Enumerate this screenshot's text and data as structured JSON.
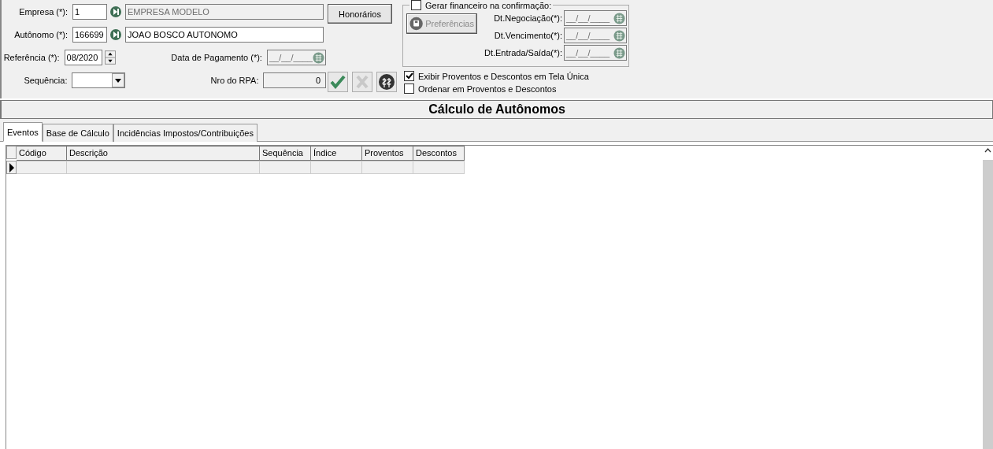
{
  "form": {
    "empresa": {
      "label": "Empresa (*):",
      "code": "1",
      "name": "EMPRESA MODELO",
      "name_disabled": true
    },
    "autonomo": {
      "label": "Autônomo (*):",
      "code": "166699",
      "name": "JOAO BOSCO AUTONOMO",
      "name_disabled": false
    },
    "referencia": {
      "label": "Referência (*):",
      "value": "08/2020"
    },
    "data_pagamento": {
      "label": "Data de Pagamento (*):",
      "value": "__/__/____",
      "disabled": true
    },
    "sequencia": {
      "label": "Sequência:"
    },
    "nro_rpa": {
      "label": "Nro do RPA:",
      "value": "0"
    }
  },
  "honorarios_button": {
    "label": "Honorários"
  },
  "action_buttons": [
    {
      "kind": "confirm",
      "disabled": false
    },
    {
      "kind": "cancel",
      "disabled": true
    },
    {
      "kind": "money",
      "disabled": false
    }
  ],
  "financeiro": {
    "label": "Gerar financeiro na confirmação:",
    "checked": false,
    "preferencias": {
      "label": "Preferências",
      "disabled": true
    },
    "dates": [
      {
        "label": "Dt.Negociação(*):",
        "value": "__/__/____"
      },
      {
        "label": "Dt.Vencimento(*):",
        "value": "__/__/____"
      },
      {
        "label": "Dt.Entrada/Saída(*):",
        "value": "__/__/____"
      }
    ]
  },
  "options": [
    {
      "label": "Exibir Proventos e Descontos em Tela Única",
      "checked": true
    },
    {
      "label": "Ordenar em Proventos e Descontos",
      "checked": false
    }
  ],
  "title": "Cálculo de Autônomos",
  "tabs": [
    {
      "label": "Eventos",
      "selected": true
    },
    {
      "label": "Base de Cálculo",
      "selected": false
    },
    {
      "label": "Incidências Impostos/Contribuições",
      "selected": false
    }
  ],
  "table": {
    "columns": [
      "Código",
      "Descrição",
      "Sequência",
      "Índice",
      "Proventos",
      "Descontos"
    ]
  }
}
